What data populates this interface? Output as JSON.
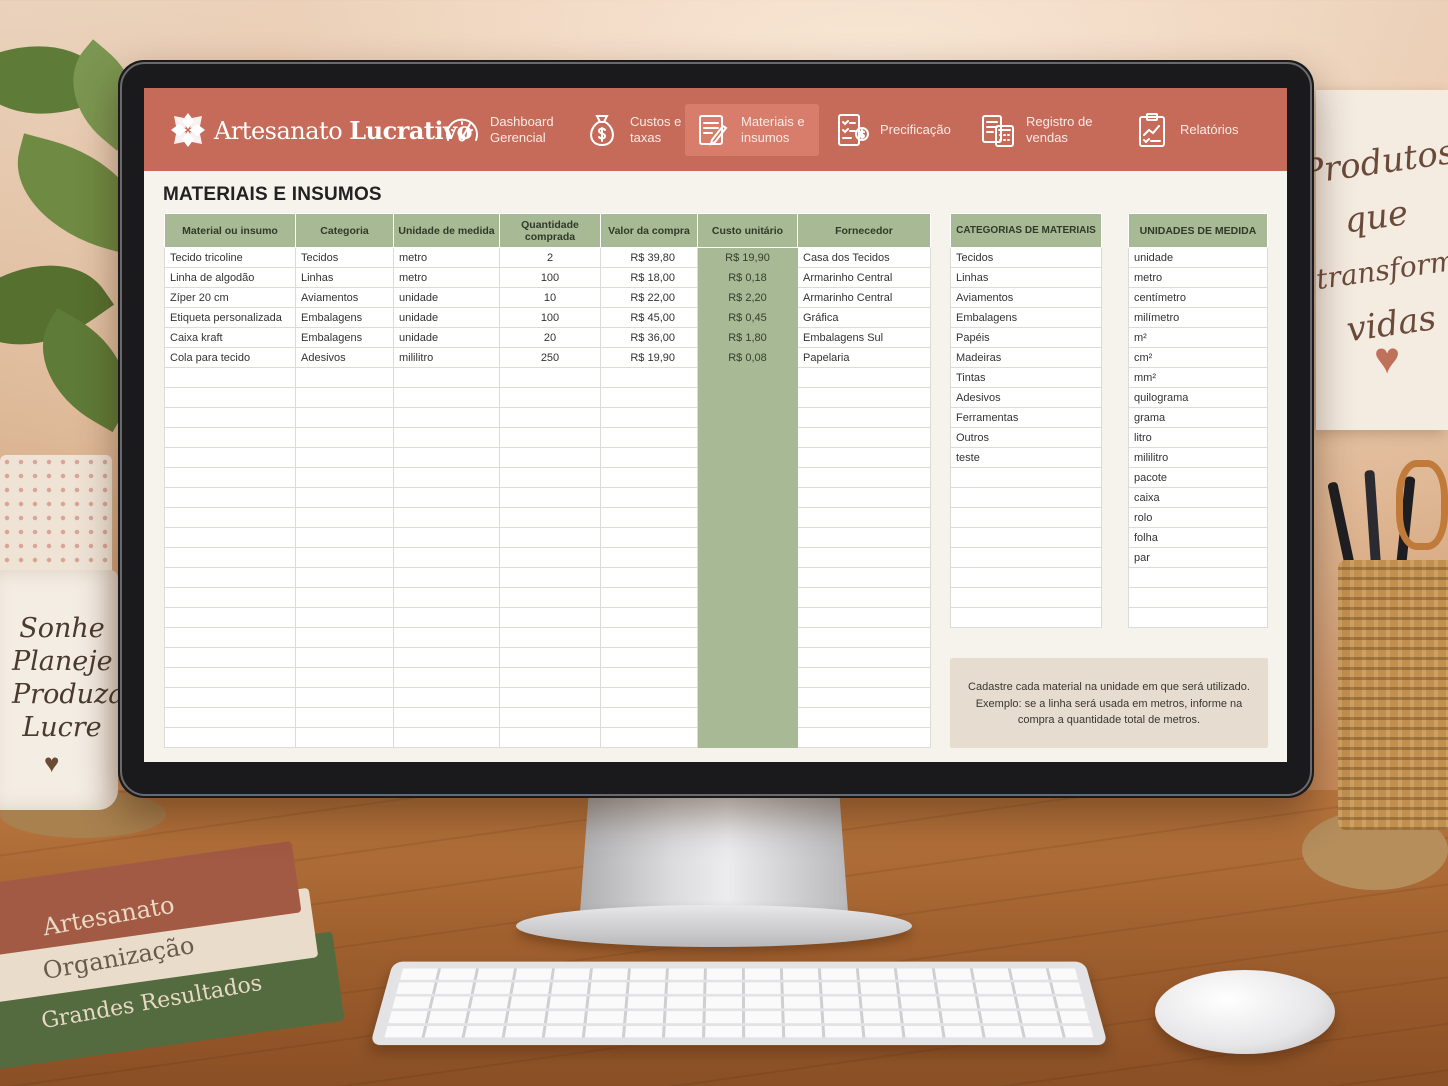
{
  "app": {
    "logo_light": "Artesanato ",
    "logo_bold": "Lucrativo"
  },
  "nav": [
    {
      "label": "Dashboard Gerencial",
      "icon": "gauge-icon"
    },
    {
      "label": "Custos e taxas",
      "icon": "money-bag-icon"
    },
    {
      "label": "Materiais e insumos",
      "icon": "notepad-pencil-icon",
      "active": true
    },
    {
      "label": "Precificação",
      "icon": "price-checklist-icon"
    },
    {
      "label": "Registro de vendas",
      "icon": "calculator-icon"
    },
    {
      "label": "Relatórios",
      "icon": "clipboard-chart-icon"
    }
  ],
  "page": {
    "title": "MATERIAIS E INSUMOS"
  },
  "materials_table": {
    "headers": [
      "Material ou insumo",
      "Categoria",
      "Unidade de medida",
      "Quantidade comprada",
      "Valor da compra",
      "Custo unitário",
      "Fornecedor"
    ],
    "rows": [
      [
        "Tecido tricoline",
        "Tecidos",
        "metro",
        "2",
        "R$ 39,80",
        "R$ 19,90",
        "Casa dos Tecidos"
      ],
      [
        "Linha de algodão",
        "Linhas",
        "metro",
        "100",
        "R$ 18,00",
        "R$ 0,18",
        "Armarinho Central"
      ],
      [
        "Zíper 20 cm",
        "Aviamentos",
        "unidade",
        "10",
        "R$ 22,00",
        "R$ 2,20",
        "Armarinho Central"
      ],
      [
        "Etiqueta personalizada",
        "Embalagens",
        "unidade",
        "100",
        "R$ 45,00",
        "R$ 0,45",
        "Gráfica"
      ],
      [
        "Caixa kraft",
        "Embalagens",
        "unidade",
        "20",
        "R$ 36,00",
        "R$ 1,80",
        "Embalagens Sul"
      ],
      [
        "Cola para tecido",
        "Adesivos",
        "mililitro",
        "250",
        "R$ 19,90",
        "R$ 0,08",
        "Papelaria"
      ]
    ],
    "empty_rows": 19
  },
  "categories_table": {
    "header": "CATEGORIAS DE MATERIAIS",
    "items": [
      "Tecidos",
      "Linhas",
      "Aviamentos",
      "Embalagens",
      "Papéis",
      "Madeiras",
      "Tintas",
      "Adesivos",
      "Ferramentas",
      "Outros",
      "teste"
    ],
    "empty_rows": 8
  },
  "units_table": {
    "header": "UNIDADES DE MEDIDA",
    "items": [
      "unidade",
      "metro",
      "centímetro",
      "milímetro",
      "m²",
      "cm²",
      "mm²",
      "quilograma",
      "grama",
      "litro",
      "mililitro",
      "pacote",
      "caixa",
      "rolo",
      "folha",
      "par"
    ],
    "empty_rows": 3
  },
  "note": {
    "line1": "Cadastre cada material na unidade em que será utilizado.",
    "line2": "Exemplo: se a linha será usada em metros, informe na",
    "line3": "compra a quantidade total de metros."
  },
  "scene": {
    "mug_lines": [
      "Sonhe",
      "Planeje",
      "Produza",
      "Lucre"
    ],
    "sign_lines": [
      "Produtos",
      "que",
      "transforma",
      "vidas"
    ],
    "books": [
      "Artesanato",
      "Organização",
      "Grandes Resultados"
    ]
  },
  "colors": {
    "header_bg": "#c66b5a",
    "header_active": "#d87d6b",
    "table_header": "#a8b996",
    "note_bg": "#e6ddd0"
  }
}
